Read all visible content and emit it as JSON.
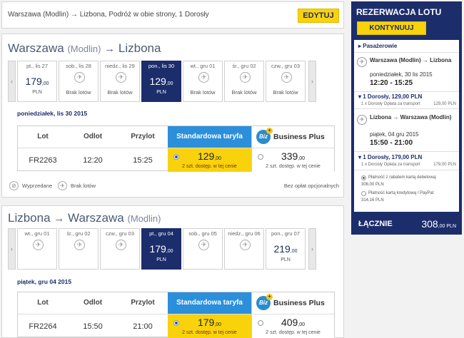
{
  "summary": {
    "text": "Warszawa (Modlin) → Lizbona, Podróż w obie strony, 1 Dorosły",
    "edit_label": "EDYTUJ"
  },
  "outbound": {
    "from": "Warszawa",
    "from_sub": "(Modlin)",
    "arrow": "→",
    "to": "Lizbona",
    "to_sub": "",
    "dates": [
      {
        "label": "pt., lis 27",
        "price": "179",
        "dec": ",00",
        "cur": "PLN",
        "nof": ""
      },
      {
        "label": "sob., lis 28",
        "price": "",
        "dec": "",
        "cur": "",
        "nof": "Brak lotów"
      },
      {
        "label": "niedz., lis 29",
        "price": "",
        "dec": "",
        "cur": "",
        "nof": "Brak lotów"
      },
      {
        "label": "pon., lis 30",
        "price": "129",
        "dec": ",00",
        "cur": "PLN",
        "nof": ""
      },
      {
        "label": "wt., gru 01",
        "price": "",
        "dec": "",
        "cur": "",
        "nof": "Brak lotów"
      },
      {
        "label": "śr., gru 02",
        "price": "",
        "dec": "",
        "cur": "",
        "nof": "Brak lotów"
      },
      {
        "label": "czw., gru 03",
        "price": "",
        "dec": "",
        "cur": "",
        "nof": "Brak lotów"
      }
    ],
    "day_heading": "poniedziałek, lis 30 2015",
    "table": {
      "h_lot": "Lot",
      "h_odlot": "Odlot",
      "h_przylot": "Przylot",
      "h_std": "Standardowa taryfa",
      "biz_logo": "Biz",
      "h_biz": "Business Plus",
      "flight": "FR2263",
      "dep": "12:20",
      "arr": "15:25",
      "std_price": "129",
      "std_dec": ",00",
      "std_note": "2 szt. dostęp. w tej cenie",
      "biz_price": "339",
      "biz_dec": ",00",
      "biz_note": "2 szt. dostęp. w tej cenie"
    },
    "legend": {
      "sold": "Wyprzedane",
      "none": "Brak lotów",
      "fees": "Bez opłat opcjonalnych"
    }
  },
  "return": {
    "from": "Lizbona",
    "arrow": "→",
    "to": "Warszawa",
    "to_sub": "(Modlin)",
    "dates": [
      {
        "label": "wt., gru 01",
        "price": "",
        "dec": "",
        "cur": "",
        "nof": ""
      },
      {
        "label": "śr., gru 02",
        "price": "",
        "dec": "",
        "cur": "",
        "nof": ""
      },
      {
        "label": "czw., gru 03",
        "price": "",
        "dec": "",
        "cur": "",
        "nof": ""
      },
      {
        "label": "pt., gru 04",
        "price": "179",
        "dec": ",00",
        "cur": "PLN",
        "nof": ""
      },
      {
        "label": "sob., gru 05",
        "price": "",
        "dec": "",
        "cur": "",
        "nof": ""
      },
      {
        "label": "niedz., gru 06",
        "price": "",
        "dec": "",
        "cur": "",
        "nof": ""
      },
      {
        "label": "pon., gru 07",
        "price": "219",
        "dec": ",00",
        "cur": "PLN",
        "nof": ""
      }
    ],
    "day_heading": "piątek, gru 04 2015",
    "table": {
      "h_lot": "Lot",
      "h_odlot": "Odlot",
      "h_przylot": "Przylot",
      "h_std": "Standardowa taryfa",
      "biz_logo": "Biz",
      "h_biz": "Business Plus",
      "flight": "FR2264",
      "dep": "15:50",
      "arr": "21:00",
      "std_price": "179",
      "std_dec": ",00",
      "std_note": "2 szt. dostęp. w tej cenie",
      "biz_price": "409",
      "biz_dec": ",00",
      "biz_note": "2 szt. dostęp. w tej cenie"
    }
  },
  "sidebar": {
    "title": "REZERWACJA LOTU",
    "continue_label": "KONTYNUUJ",
    "passengers_link": "▸ Pasażerowie",
    "out_route": "Warszawa (Modlin) → Lizbona",
    "out_date": "poniedziałek, 30 lis 2015",
    "out_time": "12:20 - 15:25",
    "out_total": "▾ 1 Dorosły, 129,00 PLN",
    "out_fee": "1 x Dorosły Opłata za transport",
    "out_fee_val": "129,00 PLN",
    "ret_route": "Lizbona → Warszawa (Modlin)",
    "ret_date": "piątek, 04 gru 2015",
    "ret_time": "15:50 - 21:00",
    "ret_total": "▾ 1 Dorosły, 179,00 PLN",
    "ret_fee": "1 x Dorosły Opłata za transport",
    "ret_fee_val": "179,00 PLN",
    "pay_debit": "Płatność z rabatem kartą debetową:",
    "pay_debit_val": "308,00 PLN",
    "pay_credit": "Płatność kartą kredytową / PayPal:",
    "pay_credit_val": "314,16 PLN",
    "total_label": "ŁĄCZNIE",
    "total_value": "308",
    "total_dec": ",00 PLN"
  },
  "icons": {
    "plane": "✈",
    "left_arrow": "‹",
    "right_arrow": "›"
  }
}
